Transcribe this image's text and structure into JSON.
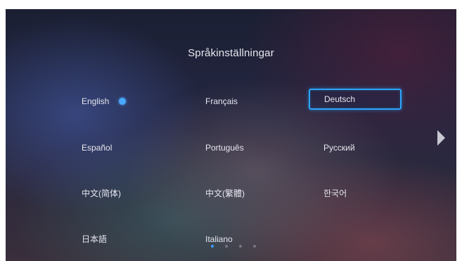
{
  "title": "Språkinställningar",
  "languages": [
    {
      "label": "English",
      "selected": true
    },
    {
      "label": "Français"
    },
    {
      "label": "Deutsch",
      "focused": true
    },
    {
      "label": "Español"
    },
    {
      "label": "Português"
    },
    {
      "label": "Русский"
    },
    {
      "label": "中文(简体)"
    },
    {
      "label": "中文(繁體)"
    },
    {
      "label": "한국어"
    },
    {
      "label": "日本語"
    },
    {
      "label": "Italiano"
    }
  ],
  "navigation": {
    "next_icon": "chevron-right-icon"
  },
  "pagination": {
    "pages": 4,
    "current": 1
  },
  "colors": {
    "accent": "#2aa7ff",
    "selected_dot": "#4aa8ff"
  }
}
